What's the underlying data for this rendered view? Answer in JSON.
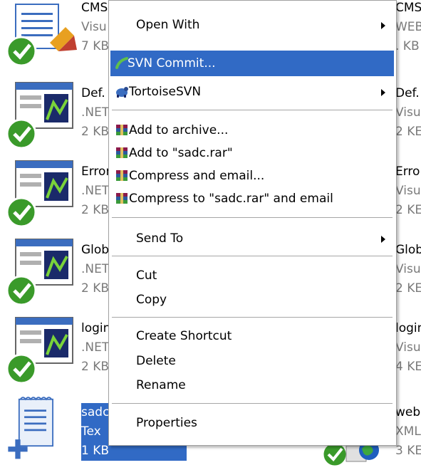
{
  "left_files": [
    {
      "name": "CMS",
      "type": "Visu",
      "size": "7 KB"
    },
    {
      "name": "Def.",
      "type": ".NET",
      "size": "2 KB"
    },
    {
      "name": "Error",
      "type": ".NET",
      "size": "2 KB"
    },
    {
      "name": "Glob",
      "type": ".NET",
      "size": "2 KB"
    },
    {
      "name": "login",
      "type": ".NET",
      "size": "2 KB"
    },
    {
      "name": "sadc",
      "type": "Tex",
      "size": "1 KB"
    }
  ],
  "right_files": [
    {
      "name": "CMS",
      "type": "WEB",
      "size": ". KB"
    },
    {
      "name": "Def.",
      "type": "Visu",
      "size": "2 KE"
    },
    {
      "name": "Erro",
      "type": "Visu",
      "size": "2 KE"
    },
    {
      "name": "Glob",
      "type": "Visu",
      "size": "2 KE"
    },
    {
      "name": "login",
      "type": "Visu",
      "size": "4 KE"
    },
    {
      "name": "web",
      "type": "XML",
      "size": "3 KE"
    }
  ],
  "context_menu": {
    "open_with": "Open With",
    "svn_commit": "SVN Commit...",
    "tortoise_svn": "TortoiseSVN",
    "add_to_archive": "Add to archive...",
    "add_to_rar": "Add to \"sadc.rar\"",
    "compress_email": "Compress and email...",
    "compress_rar_email": "Compress to \"sadc.rar\" and email",
    "send_to": "Send To",
    "cut": "Cut",
    "copy": "Copy",
    "create_shortcut": "Create Shortcut",
    "delete": "Delete",
    "rename": "Rename",
    "properties": "Properties"
  },
  "colors": {
    "highlight": "#316ac5",
    "check": "#3a9a2a"
  }
}
